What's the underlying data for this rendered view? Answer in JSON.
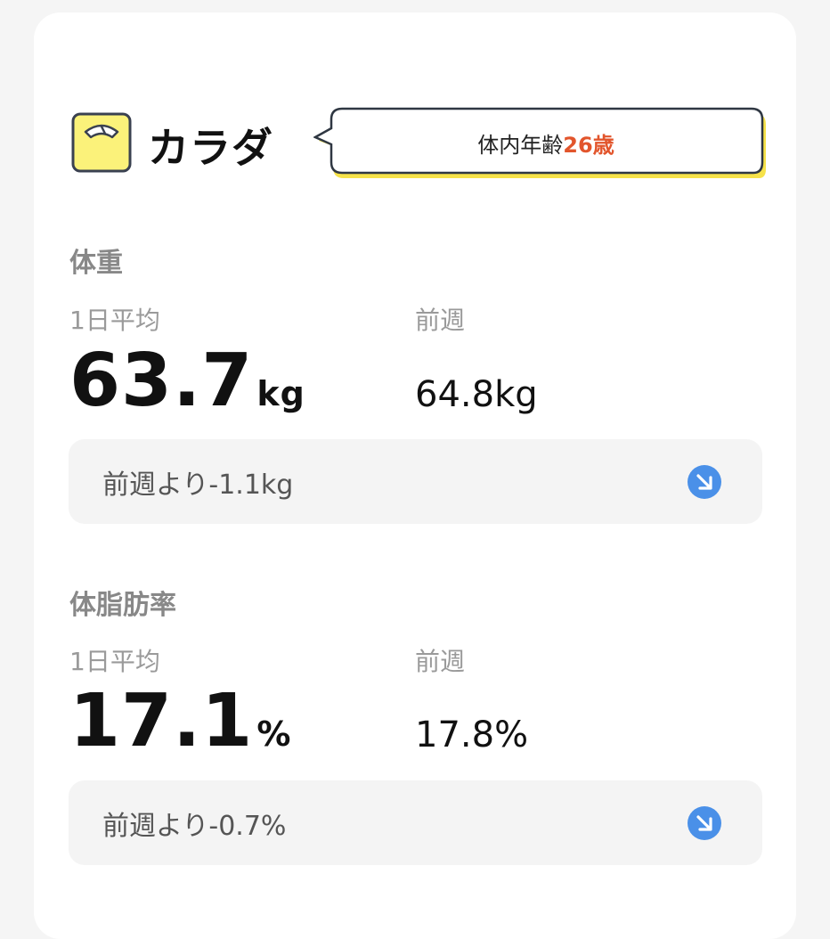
{
  "body": {
    "title": "カラダ",
    "age_label": "体内年齢",
    "age_value": "26歳"
  },
  "weight": {
    "section": "体重",
    "avg_label": "1日平均",
    "avg_value": "63.7",
    "avg_unit": "kg",
    "prev_label": "前週",
    "prev_value": "64.8kg",
    "diff_text": "前週より-1.1kg",
    "trend_icon": "arrow-down-right-icon"
  },
  "body_fat": {
    "section": "体脂肪率",
    "avg_label": "1日平均",
    "avg_value": "17.1",
    "avg_unit": "%",
    "prev_label": "前週",
    "prev_value": "17.8%",
    "diff_text": "前週より-0.7%",
    "trend_icon": "arrow-down-right-icon"
  },
  "colors": {
    "accent_age": "#e2552c",
    "trend_icon": "#4a90e8",
    "icon_yellow": "#fbf27a",
    "bubble_shadow": "#f6e24a"
  }
}
